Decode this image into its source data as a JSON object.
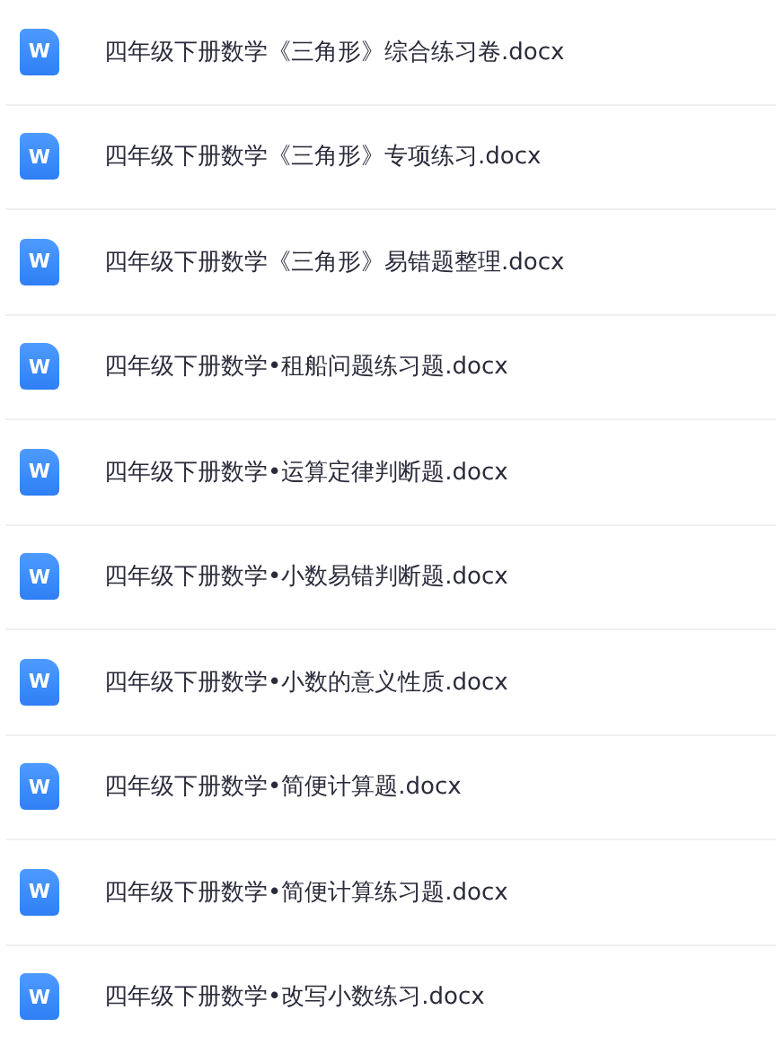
{
  "files": [
    {
      "icon": "W",
      "name": "四年级下册数学《三角形》综合练习卷.docx"
    },
    {
      "icon": "W",
      "name": "四年级下册数学《三角形》专项练习.docx"
    },
    {
      "icon": "W",
      "name": "四年级下册数学《三角形》易错题整理.docx"
    },
    {
      "icon": "W",
      "name": "四年级下册数学•租船问题练习题.docx"
    },
    {
      "icon": "W",
      "name": "四年级下册数学•运算定律判断题.docx"
    },
    {
      "icon": "W",
      "name": "四年级下册数学•小数易错判断题.docx"
    },
    {
      "icon": "W",
      "name": "四年级下册数学•小数的意义性质.docx"
    },
    {
      "icon": "W",
      "name": "四年级下册数学•简便计算题.docx"
    },
    {
      "icon": "W",
      "name": "四年级下册数学•简便计算练习题.docx"
    },
    {
      "icon": "W",
      "name": "四年级下册数学•改写小数练习.docx"
    }
  ]
}
